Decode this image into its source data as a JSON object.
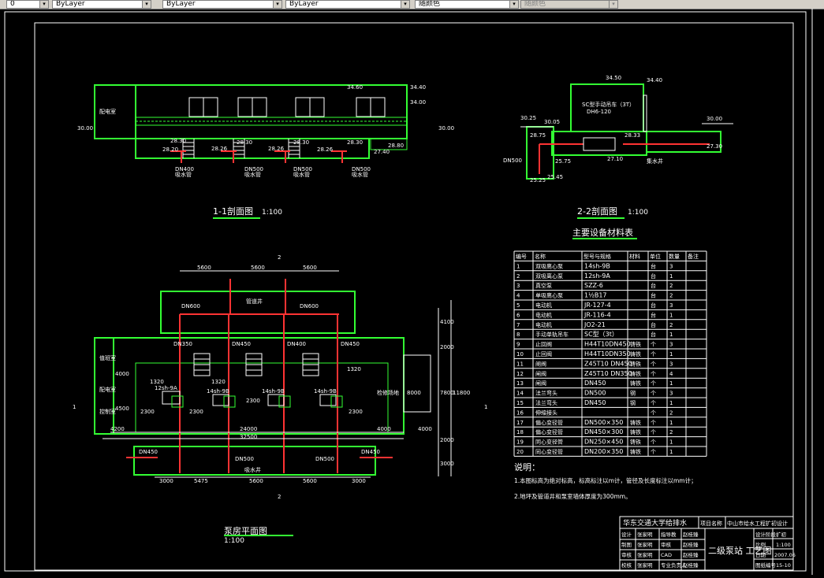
{
  "toolbar": {
    "layer_value": "0",
    "color_value": "ByLayer",
    "linetype_value": "ByLayer",
    "lineweight_value": "ByLayer",
    "plotstyle_value": "随颜色"
  },
  "drawing": {
    "sec1": {
      "title": "1-1剖面图",
      "scale": "1:100",
      "room": "配电室",
      "elev": [
        "34.60",
        "34.40",
        "34.00",
        "30.00",
        "30.00",
        "28.30",
        "28.80",
        "28.30",
        "28.26",
        "28.30",
        "27.40",
        "28.30",
        "28.20",
        "28.26",
        "28.26"
      ],
      "pipes": [
        "DN400",
        "DN500",
        "DN500",
        "DN500"
      ],
      "pipe_note": "吸水管"
    },
    "sec2": {
      "title": "2-2剖面图",
      "scale": "1:100",
      "crane": "SC型手动吊车（3T）",
      "crane2": "DH6-120",
      "elev": [
        "34.50",
        "34.40",
        "30.25",
        "30.05",
        "30.00",
        "28.75",
        "28.33",
        "27.30",
        "25.75",
        "27.10",
        "25.25",
        "25.45"
      ],
      "labels": [
        "DN500",
        "集水井"
      ]
    },
    "plan": {
      "title": "泵房平面图",
      "scale": "1:100",
      "dims_top": [
        "5600",
        "5600",
        "5600"
      ],
      "dims_bottom": [
        "3000",
        "5475",
        "5600",
        "5600",
        "3000"
      ],
      "total1": "24000",
      "total2": "32500",
      "side_left": [
        "4200",
        "4000",
        "4500"
      ],
      "side_right": [
        "4000",
        "4000"
      ],
      "vert": [
        "4100",
        "2000",
        "7800",
        "11800",
        "8000",
        "2000",
        "3000"
      ],
      "pipes": [
        "DN600",
        "DN600",
        "DN500",
        "DN500",
        "DN450",
        "DN450",
        "DN350",
        "DN450",
        "DN400",
        "DN450"
      ],
      "pumps": [
        "12sh-9A",
        "14sh-9B",
        "14sh-9B",
        "14sh-9B"
      ],
      "spacing": [
        "2300",
        "2300",
        "2300",
        "2300"
      ],
      "inner": [
        "1320",
        "1320",
        "1320"
      ],
      "well1": "管道井",
      "well2": "吸水井",
      "rooms": [
        "值班室",
        "配电室",
        "控制室"
      ],
      "right_room": "检修场地",
      "sec_marks": [
        "1",
        "1",
        "2",
        "2"
      ]
    },
    "table": {
      "title": "主要设备材料表",
      "headers": [
        "编号",
        "名称",
        "型号与规格",
        "材料",
        "单位",
        "数量",
        "备注"
      ],
      "rows": [
        [
          "1",
          "双吸离心泵",
          "14sh-9B",
          "",
          "台",
          "3",
          ""
        ],
        [
          "2",
          "双吸离心泵",
          "12sh-9A",
          "",
          "台",
          "1",
          ""
        ],
        [
          "3",
          "真空泵",
          "SZZ-6",
          "",
          "台",
          "2",
          ""
        ],
        [
          "4",
          "单吸离心泵",
          "1½B17",
          "",
          "台",
          "2",
          ""
        ],
        [
          "5",
          "电动机",
          "JR-127-4",
          "",
          "台",
          "3",
          ""
        ],
        [
          "6",
          "电动机",
          "JR-116-4",
          "",
          "台",
          "1",
          ""
        ],
        [
          "7",
          "电动机",
          "JO2-21",
          "",
          "台",
          "2",
          ""
        ],
        [
          "8",
          "手动单轨吊车",
          "SC型（3t）",
          "",
          "台",
          "1",
          ""
        ],
        [
          "9",
          "止回阀",
          "H44T10DN450",
          "铸铁",
          "个",
          "3",
          ""
        ],
        [
          "10",
          "止回阀",
          "H44T10DN350",
          "铸铁",
          "个",
          "1",
          ""
        ],
        [
          "11",
          "闸阀",
          "Z45T10 DN450",
          "铸铁",
          "个",
          "3",
          ""
        ],
        [
          "12",
          "闸阀",
          "Z45T10 DN350",
          "铸铁",
          "个",
          "4",
          ""
        ],
        [
          "13",
          "闸阀",
          "DN450",
          "铸铁",
          "个",
          "1",
          ""
        ],
        [
          "14",
          "法兰弯头",
          "DN500",
          "钢",
          "个",
          "3",
          ""
        ],
        [
          "15",
          "法兰弯头",
          "DN450",
          "钢",
          "个",
          "1",
          ""
        ],
        [
          "16",
          "伸缩接头",
          "",
          "",
          "个",
          "2",
          ""
        ],
        [
          "17",
          "偏心变径管",
          "DN500×350",
          "铸铁",
          "个",
          "1",
          ""
        ],
        [
          "18",
          "偏心变径管",
          "DN450×300",
          "铸铁",
          "个",
          "2",
          ""
        ],
        [
          "19",
          "同心变径管",
          "DN250×450",
          "铸铁",
          "个",
          "1",
          ""
        ],
        [
          "20",
          "同心变径管",
          "DN200×350",
          "铸铁",
          "个",
          "1",
          ""
        ]
      ]
    },
    "notes": {
      "title": "说明：",
      "lines": [
        "1.本图标高为绝对标高，标高标注以m计，管径及长度标注以mm计；",
        "2.地坪及管道井和泵室墙体厚度为300mm。"
      ]
    },
    "titleblock": {
      "school": "华东交通大学给排水",
      "proj_label": "项目名称",
      "proj_name": "中山市给水工程扩初设计",
      "rows": [
        [
          "设计",
          "张家明",
          "指导教",
          "赵桂臻"
        ],
        [
          "制图",
          "张家明",
          "审核",
          "赵桂臻"
        ],
        [
          "审核",
          "张家明",
          "CAD",
          "赵桂臻"
        ],
        [
          "校核",
          "张家明",
          "专业负责人",
          "赵桂臻"
        ]
      ],
      "drawing_name": "二级泵站 工艺图",
      "info": [
        [
          "设计阶段",
          "扩初"
        ],
        [
          "比例",
          "1:100"
        ],
        [
          "日期",
          "2007.06"
        ],
        [
          "图纸编号",
          "15-10"
        ]
      ]
    }
  }
}
